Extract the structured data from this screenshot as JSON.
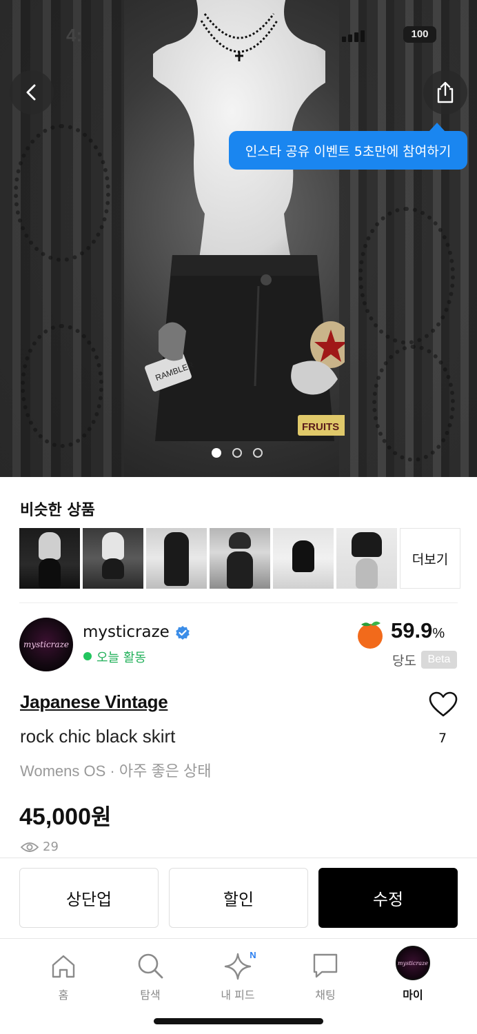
{
  "status_bar": {
    "time": "4:",
    "battery": "100"
  },
  "hero": {
    "tooltip": "인스타 공유 이벤트 5초만에 참여하기",
    "page_count": 3,
    "current_page": 1
  },
  "similar": {
    "title": "비슷한 상품",
    "more_label": "더보기"
  },
  "seller": {
    "name": "mysticraze",
    "avatar_text": "mysticraze",
    "activity": "오늘 활동",
    "score": "59.9",
    "score_unit": "%",
    "score_label": "당도",
    "beta": "Beta"
  },
  "product": {
    "brand": "Japanese Vintage",
    "name": "rock chic black skirt",
    "meta": "Womens OS · 아주 좋은 상태",
    "price": "45,000",
    "price_unit": "원",
    "views": "29",
    "likes": "7"
  },
  "actions": {
    "bump": "상단업",
    "discount": "할인",
    "edit": "수정"
  },
  "tabbar": {
    "home": "홈",
    "search": "탐색",
    "feed": "내 피드",
    "feed_badge": "N",
    "chat": "채팅",
    "my": "마이",
    "avatar_text": "mysticraze"
  },
  "colors": {
    "accent_blue": "#1a86f0",
    "online_green": "#22c55e",
    "primary_button": "#000000"
  }
}
